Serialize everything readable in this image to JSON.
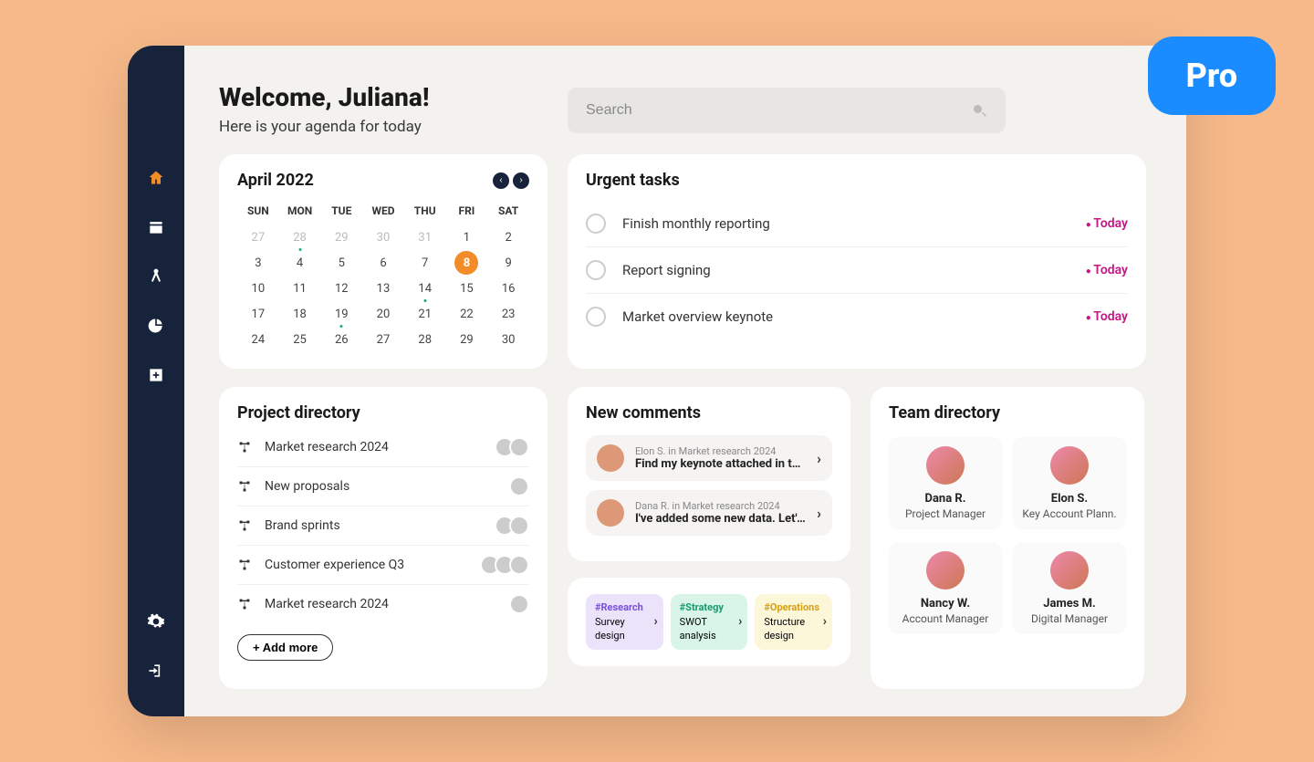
{
  "badge": "Pro",
  "header": {
    "title": "Welcome, Juliana!",
    "subtitle": "Here is your agenda for today"
  },
  "search": {
    "placeholder": "Search"
  },
  "calendar": {
    "title": "April 2022",
    "dow": [
      "SUN",
      "MON",
      "TUE",
      "WED",
      "THU",
      "FRI",
      "SAT"
    ],
    "weeks": [
      [
        {
          "n": "27",
          "muted": true
        },
        {
          "n": "28",
          "muted": true,
          "dot": true
        },
        {
          "n": "29",
          "muted": true
        },
        {
          "n": "30",
          "muted": true
        },
        {
          "n": "31",
          "muted": true
        },
        {
          "n": "1"
        },
        {
          "n": "2"
        }
      ],
      [
        {
          "n": "3"
        },
        {
          "n": "4"
        },
        {
          "n": "5"
        },
        {
          "n": "6"
        },
        {
          "n": "7"
        },
        {
          "n": "8",
          "selected": true
        },
        {
          "n": "9"
        }
      ],
      [
        {
          "n": "10"
        },
        {
          "n": "11"
        },
        {
          "n": "12"
        },
        {
          "n": "13"
        },
        {
          "n": "14",
          "dot": true
        },
        {
          "n": "15"
        },
        {
          "n": "16"
        }
      ],
      [
        {
          "n": "17"
        },
        {
          "n": "18"
        },
        {
          "n": "19",
          "dot": true
        },
        {
          "n": "20"
        },
        {
          "n": "21"
        },
        {
          "n": "22"
        },
        {
          "n": "23"
        }
      ],
      [
        {
          "n": "24"
        },
        {
          "n": "25"
        },
        {
          "n": "26"
        },
        {
          "n": "27"
        },
        {
          "n": "28"
        },
        {
          "n": "29"
        },
        {
          "n": "30"
        }
      ]
    ]
  },
  "urgent": {
    "title": "Urgent tasks",
    "tasks": [
      {
        "name": "Finish monthly reporting",
        "tag": "Today"
      },
      {
        "name": "Report signing",
        "tag": "Today"
      },
      {
        "name": "Market overview keynote",
        "tag": "Today"
      }
    ]
  },
  "projects": {
    "title": "Project directory",
    "items": [
      {
        "name": "Market research 2024",
        "avatars": 2
      },
      {
        "name": "New proposals",
        "avatars": 1
      },
      {
        "name": "Brand sprints",
        "avatars": 2
      },
      {
        "name": "Customer experience Q3",
        "avatars": 3
      },
      {
        "name": "Market research 2024",
        "avatars": 1
      }
    ],
    "add_more": "+ Add more"
  },
  "comments": {
    "title": "New comments",
    "items": [
      {
        "meta": "Elon S. in Market research 2024",
        "body": "Find my keynote attached in the.."
      },
      {
        "meta": "Dana R. in Market research 2024",
        "body": "I've added some new data. Let's.."
      }
    ]
  },
  "tags": [
    {
      "hash": "#Research",
      "label": "Survey design",
      "cls": "tag-purple"
    },
    {
      "hash": "#Strategy",
      "label": "SWOT analysis",
      "cls": "tag-green"
    },
    {
      "hash": "#Operations",
      "label": "Structure design",
      "cls": "tag-yellow"
    }
  ],
  "team": {
    "title": "Team directory",
    "members": [
      {
        "name": "Dana R.",
        "role": "Project Manager"
      },
      {
        "name": "Elon S.",
        "role": "Key Account Plann."
      },
      {
        "name": "Nancy W.",
        "role": "Account Manager"
      },
      {
        "name": "James M.",
        "role": "Digital Manager"
      }
    ]
  }
}
